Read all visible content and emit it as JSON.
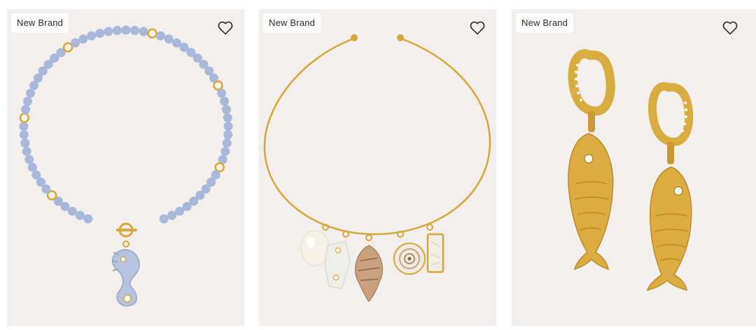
{
  "colors": {
    "card_bg": "#f2efec",
    "gold": "#d7a93c",
    "bead_blue": "#a9b8d9",
    "pearl": "#f7f3ea"
  },
  "products": [
    {
      "badge": "New Brand",
      "wishlist_icon": "heart-outline-icon",
      "image": "seahorse-beaded-pearl-necklace"
    },
    {
      "badge": "New Brand",
      "wishlist_icon": "heart-outline-icon",
      "image": "gold-cuff-necklace-shell-charms"
    },
    {
      "badge": "New Brand",
      "wishlist_icon": "heart-outline-icon",
      "image": "gold-fish-huggie-earrings"
    }
  ]
}
